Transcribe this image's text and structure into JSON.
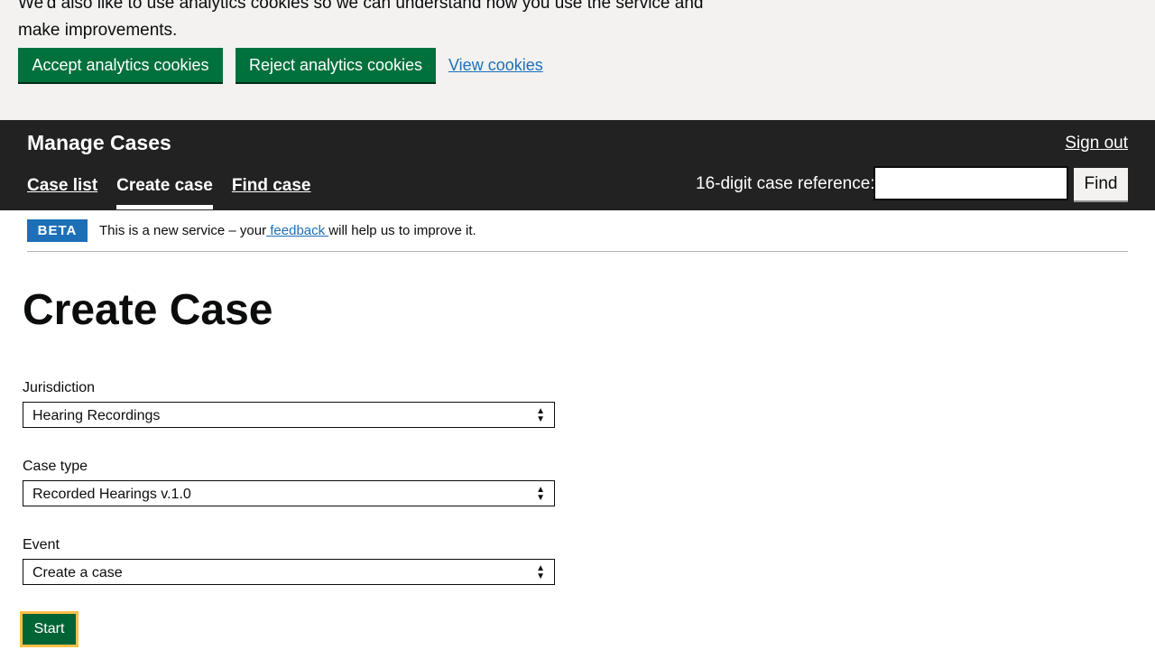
{
  "cookie_banner": {
    "text": "We'd also like to use analytics cookies so we can understand how you use the service and make improvements.",
    "accept_label": "Accept analytics cookies",
    "reject_label": "Reject analytics cookies",
    "view_label": "View cookies"
  },
  "header": {
    "service_name": "Manage Cases",
    "sign_out": "Sign out",
    "nav": [
      "Case list",
      "Create case",
      "Find case"
    ],
    "search_label": "16-digit case reference:",
    "search_value": "",
    "find_label": "Find"
  },
  "beta": {
    "tag": "BETA",
    "text_before": "This is a new service – your",
    "link": " feedback ",
    "text_after": "will help us to improve it."
  },
  "main": {
    "title": "Create Case",
    "jurisdiction": {
      "label": "Jurisdiction",
      "value": "Hearing Recordings"
    },
    "case_type": {
      "label": "Case type",
      "value": "Recorded Hearings v.1.0"
    },
    "event": {
      "label": "Event",
      "value": "Create a case"
    },
    "start_label": "Start"
  },
  "colors": {
    "primary_green": "#00703c",
    "header_bg": "#222222",
    "link_blue": "#1d70b8",
    "focus_yellow": "#ffbf47"
  }
}
